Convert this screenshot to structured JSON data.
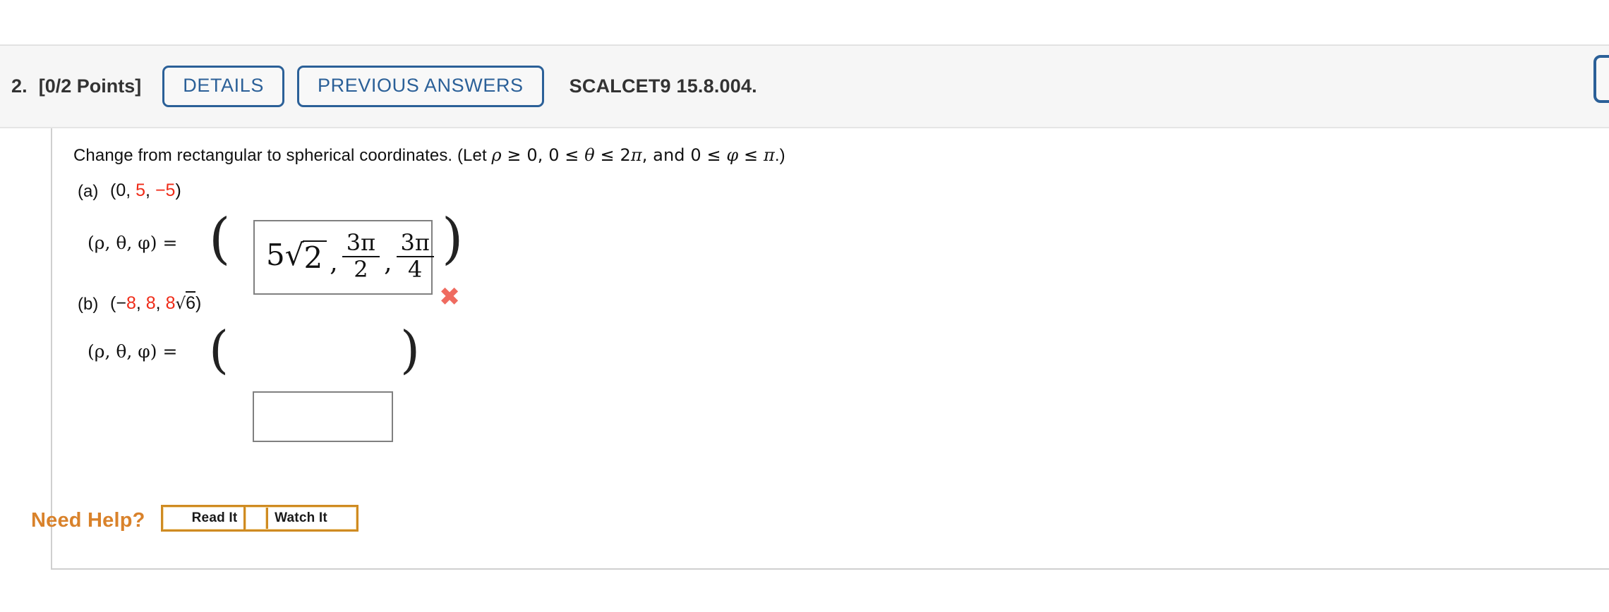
{
  "header": {
    "question_number": "2.",
    "points_label": "[0/2 Points]",
    "details_label": "DETAILS",
    "previous_answers_label": "PREVIOUS ANSWERS",
    "textbook_reference": "SCALCET9 15.8.004."
  },
  "colors": {
    "accent_blue": "#2b6098",
    "error_red": "#ef2b18",
    "x_mark_red": "#ef6b60",
    "need_help_orange": "#d9822b",
    "header_band": "#f6f6f6",
    "box_border": "#808080"
  },
  "question": {
    "prompt_prefix": "Change from rectangular to spherical coordinates. (Let ",
    "prompt_rho": "ρ",
    "prompt_cond1": " ≥ 0, 0 ≤ ",
    "prompt_theta": "θ",
    "prompt_cond2": " ≤ 2",
    "prompt_pi1": "π",
    "prompt_cond3": ", and 0 ≤ ",
    "prompt_phi": "φ",
    "prompt_cond4": " ≤ ",
    "prompt_pi2": "π",
    "prompt_suffix": ".)"
  },
  "parts": [
    {
      "label": "(a)",
      "given": {
        "open_paren": "(",
        "x": "0",
        "sep1": ", ",
        "y": "5",
        "sep2": ", ",
        "z": "−5",
        "close_paren": ")"
      },
      "lhs": "(ρ, θ, φ) =",
      "answer": {
        "filled": true,
        "rho_coef": "5",
        "rho_radical": "√",
        "rho_radicand": "2",
        "theta_num": "3π",
        "theta_den": "2",
        "phi_num": "3π",
        "phi_den": "4",
        "comma": ","
      },
      "status": "incorrect",
      "status_mark": "✖"
    },
    {
      "label": "(b)",
      "given": {
        "open_paren": "(",
        "minus": "−",
        "x": "8",
        "sep1": ", ",
        "y": "8",
        "sep2": ", ",
        "z_coef": "8",
        "z_radical": "√",
        "z_radicand": "6",
        "close_paren": ")"
      },
      "lhs": "(ρ, θ, φ) =",
      "answer": {
        "filled": false,
        "value": "",
        "placeholder": ""
      },
      "status": "unanswered"
    }
  ],
  "need_help": {
    "label": "Need Help?",
    "read_it_label": "Read It",
    "watch_it_label": "Watch It"
  }
}
